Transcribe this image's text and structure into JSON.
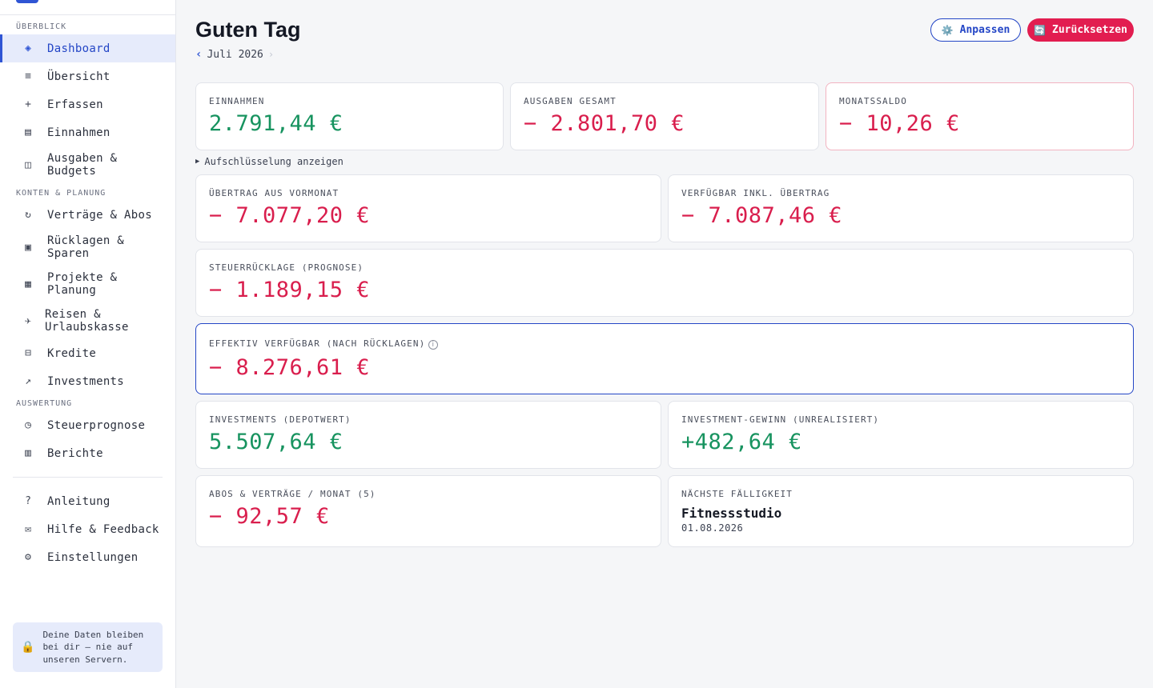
{
  "sidebar": {
    "sections": {
      "overview": "ÜBERBLICK",
      "accounts": "KONTEN & PLANUNG",
      "evaluation": "AUSWERTUNG"
    },
    "items": [
      {
        "label": "Dashboard",
        "icon": "◈"
      },
      {
        "label": "Übersicht",
        "icon": "≡"
      },
      {
        "label": "Erfassen",
        "icon": "+"
      },
      {
        "label": "Einnahmen",
        "icon": "▤"
      },
      {
        "label": "Ausgaben & Budgets",
        "icon": "◫"
      },
      {
        "label": "Verträge & Abos",
        "icon": "↻"
      },
      {
        "label": "Rücklagen & Sparen",
        "icon": "▣"
      },
      {
        "label": "Projekte & Planung",
        "icon": "▦"
      },
      {
        "label": "Reisen & Urlaubskasse",
        "icon": "✈"
      },
      {
        "label": "Kredite",
        "icon": "⊟"
      },
      {
        "label": "Investments",
        "icon": "↗"
      },
      {
        "label": "Steuerprognose",
        "icon": "◷"
      },
      {
        "label": "Berichte",
        "icon": "▥"
      },
      {
        "label": "Anleitung",
        "icon": "?"
      },
      {
        "label": "Hilfe & Feedback",
        "icon": "✉"
      },
      {
        "label": "Einstellungen",
        "icon": "⚙"
      }
    ],
    "privacy": {
      "icon": "🔒",
      "text": "Deine Daten bleiben bei dir – nie auf unseren Servern."
    }
  },
  "header": {
    "title": "Guten Tag",
    "month": "Juli 2026",
    "prev_icon": "‹",
    "next_icon": "›",
    "customize_label": "Anpassen",
    "customize_icon": "⚙️",
    "reset_label": "Zurücksetzen",
    "reset_icon": "🔄"
  },
  "breakdown_label": "Aufschlüsselung anzeigen",
  "cards": {
    "income": {
      "label": "EINNAHMEN",
      "value": "2.791,44 €"
    },
    "expenses": {
      "label": "AUSGABEN GESAMT",
      "value": "− 2.801,70 €"
    },
    "balance": {
      "label": "MONATSSALDO",
      "value": "− 10,26 €"
    },
    "carryover": {
      "label": "ÜBERTRAG AUS VORMONAT",
      "value": "− 7.077,20 €"
    },
    "available_incl": {
      "label": "VERFÜGBAR INKL. ÜBERTRAG",
      "value": "− 7.087,46 €"
    },
    "tax_reserve": {
      "label": "STEUERRÜCKLAGE (PROGNOSE)",
      "value": "− 1.189,15 €"
    },
    "effective": {
      "label": "EFFEKTIV VERFÜGBAR (NACH RÜCKLAGEN)",
      "value": "− 8.276,61 €",
      "info_icon": "i"
    },
    "investments": {
      "label": "INVESTMENTS (DEPOTWERT)",
      "value": "5.507,64 €"
    },
    "investment_gain": {
      "label": "INVESTMENT-GEWINN (UNREALISIERT)",
      "value": "+482,64 €"
    },
    "subscriptions": {
      "label": "ABOS & VERTRÄGE / MONAT (5)",
      "value": "− 92,57 €"
    },
    "next_due": {
      "label": "NÄCHSTE FÄLLIGKEIT",
      "title": "Fitnessstudio",
      "date": "01.08.2026"
    }
  },
  "colors": {
    "accent": "#2f55d4",
    "positive": "#17935f",
    "negative": "#d91e4d",
    "reset_button": "#e21d50"
  }
}
